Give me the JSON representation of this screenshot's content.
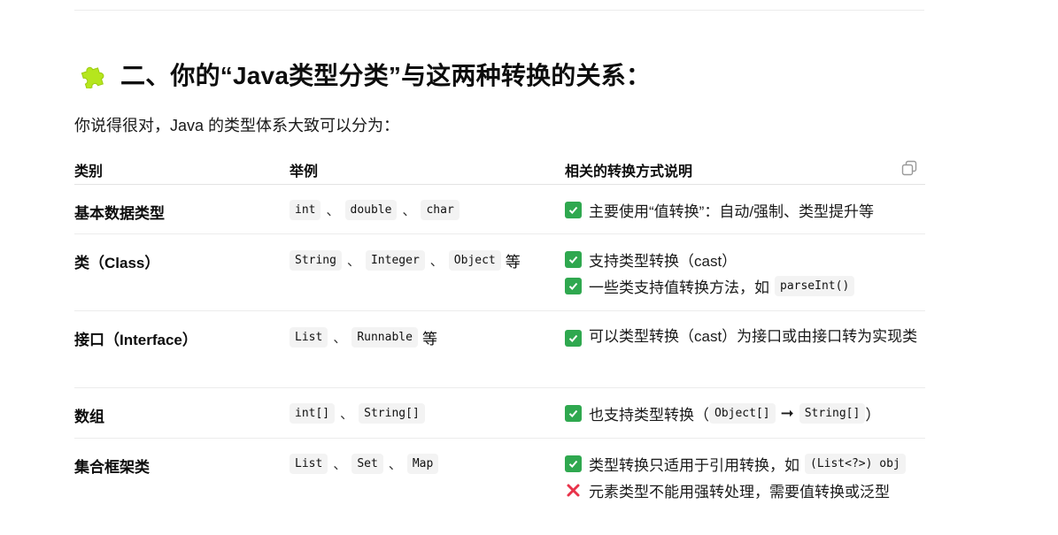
{
  "heading": {
    "icon": "puzzle-icon",
    "title": "二、你的“Java类型分类”与这两种转换的关系："
  },
  "intro": "你说得很对，Java 的类型体系大致可以分为：",
  "table": {
    "headers": {
      "category": "类别",
      "examples": "举例",
      "notes": "相关的转换方式说明"
    },
    "separator": "、",
    "deng": "等",
    "rows": [
      {
        "category": "基本数据类型",
        "examples": [
          "int",
          "double",
          "char"
        ],
        "suffix": "",
        "note1": "主要使用“值转换”：自动/强制、类型提升等"
      },
      {
        "category": "类（Class）",
        "examples": [
          "String",
          "Integer",
          "Object"
        ],
        "suffix": "等",
        "note1": "支持类型转换（cast）",
        "note2_text": "一些类支持值转换方法，如",
        "note2_code": "parseInt()"
      },
      {
        "category": "接口（Interface）",
        "examples": [
          "List",
          "Runnable"
        ],
        "suffix": "等",
        "note1": "可以类型转换（cast）为接口或由接口转为实现类"
      },
      {
        "category": "数组",
        "examples": [
          "int[]",
          "String[]"
        ],
        "suffix": "",
        "note1_text": "也支持类型转换（",
        "note1_code1": "Object[]",
        "note1_arrow": "➞",
        "note1_code2": "String[]",
        "note1_close": "）"
      },
      {
        "category": "集合框架类",
        "examples": [
          "List",
          "Set",
          "Map"
        ],
        "suffix": "",
        "note1_text": "类型转换只适用于引用转换，如",
        "note1_code": "(List<?>) obj",
        "note2": "元素类型不能用强转处理，需要值转换或泛型"
      }
    ]
  },
  "colors": {
    "check": "#2fa84f",
    "cross": "#e8334a",
    "puzzle": "#b5e61d"
  }
}
